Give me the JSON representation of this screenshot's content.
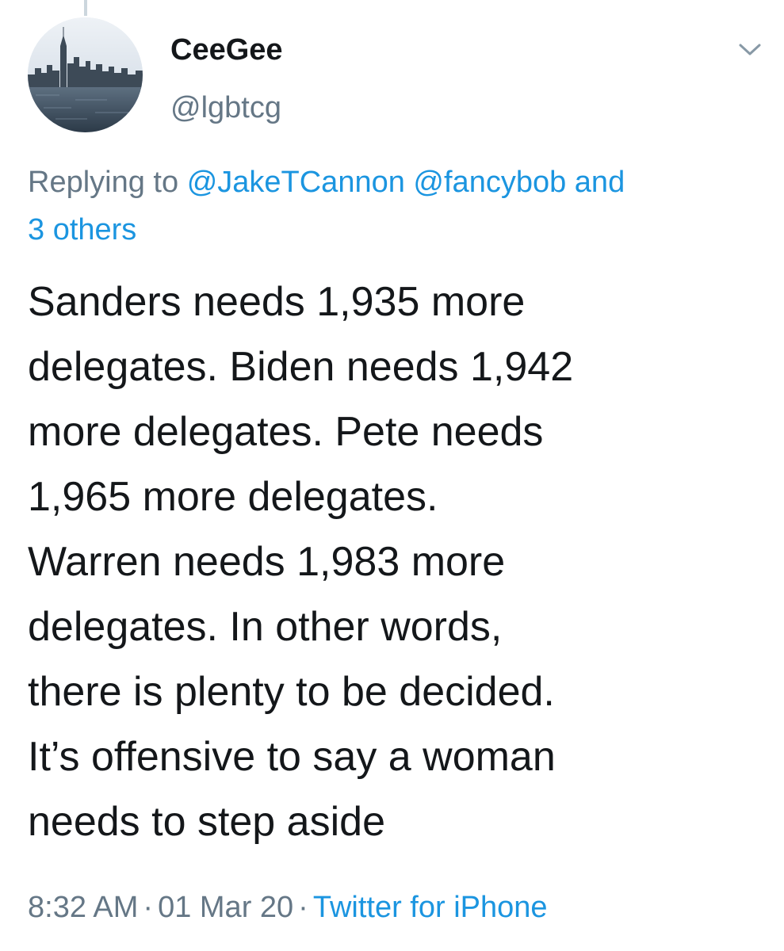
{
  "tweet": {
    "display_name": "CeeGee",
    "handle": "@lgbtcg",
    "reply": {
      "prefix": "Replying to",
      "mentions": [
        "@JakeTCannon",
        "@fancybob"
      ],
      "connector": "and",
      "others": "3 others"
    },
    "text": "Sanders needs 1,935 more\ndelegates. Biden needs 1,942\nmore delegates. Pete needs\n1,965 more delegates.\nWarren needs 1,983 more\ndelegates. In other words,\nthere is plenty to be decided.\nIt’s offensive to say a woman\nneeds to step aside",
    "time": "8:32 AM",
    "separator": "·",
    "date": "01 Mar 20",
    "source": "Twitter for iPhone"
  },
  "icons": {
    "avatar": "city-skyline-avatar",
    "menu": "chevron-down-icon"
  },
  "colors": {
    "link": "#1b95e0",
    "secondary_text": "#657786",
    "primary_text": "#14171a"
  }
}
